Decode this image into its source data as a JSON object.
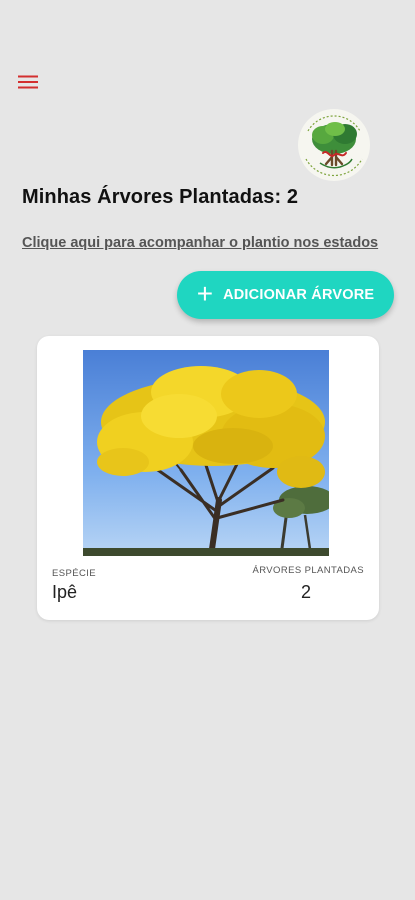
{
  "header": {
    "menu_icon": "hamburger-menu-icon",
    "logo_icon": "plantar-arvores-logo",
    "accent_color": "#d32f2f"
  },
  "main": {
    "title": "Minhas Árvores Plantadas: 2",
    "states_link": "Clique aqui para acompanhar o plantio nos estados",
    "add_button": {
      "icon": "plus-icon",
      "label": "ADICIONAR ÁRVORE",
      "color": "#1fd6c1"
    }
  },
  "trees": [
    {
      "species_label": "ESPÉCIE",
      "species": "Ipê",
      "count_label": "ÁRVORES PLANTADAS",
      "count": "2"
    }
  ]
}
